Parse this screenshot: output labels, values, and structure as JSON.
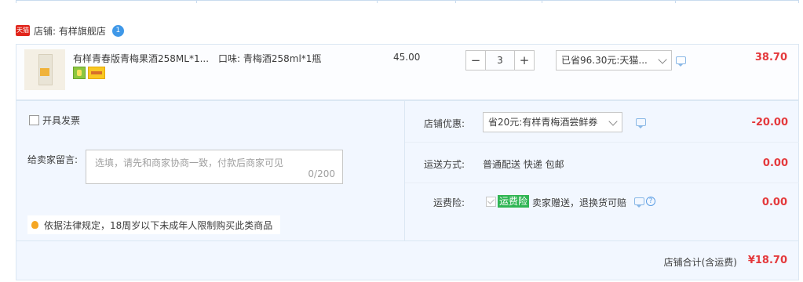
{
  "shop": {
    "badge": "天猫",
    "name": "店铺: 有样旗舰店",
    "chat_count": "1"
  },
  "item": {
    "title": "有样青春版青梅果酒258ML*1...",
    "sku": "口味: 青梅酒258ml*1瓶",
    "unit_price": "45.00",
    "quantity": "3",
    "minus_label": "−",
    "plus_label": "+",
    "promo": "已省96.30元:天猫...",
    "total": "38.70"
  },
  "invoice": {
    "label": "开具发票",
    "checked": false
  },
  "memo": {
    "label": "给卖家留言:",
    "placeholder": "选填，请先和商家协商一致，付款后商家可见",
    "count": "0/200"
  },
  "legal_notice": "依据法律规定，18周岁以下未成年人限制购买此类商品",
  "shop_discount": {
    "label": "店铺优惠:",
    "selected": "省20元:有样青梅酒尝鲜券",
    "amount": "-20.00"
  },
  "shipping": {
    "label": "运送方式:",
    "value": "普通配送 快递 包邮",
    "amount": "0.00"
  },
  "insurance": {
    "label": "运费险:",
    "badge": "运费险",
    "text": "卖家赠送，退换货可赔",
    "amount": "0.00",
    "checked": true
  },
  "footer": {
    "label": "店铺合计(含运费)",
    "total": "¥18.70"
  },
  "colors": {
    "price_red": "#e4393c",
    "panel_bg": "#f2f7ff",
    "insurance_green": "#2fb553",
    "tmall_red": "#e1251b",
    "link_blue": "#3f98e8"
  },
  "icons": [
    "tmall-badge-icon",
    "chat-bubble-icon",
    "chevron-down-icon",
    "help-icon",
    "bulb-icon",
    "product-tag-icon"
  ]
}
